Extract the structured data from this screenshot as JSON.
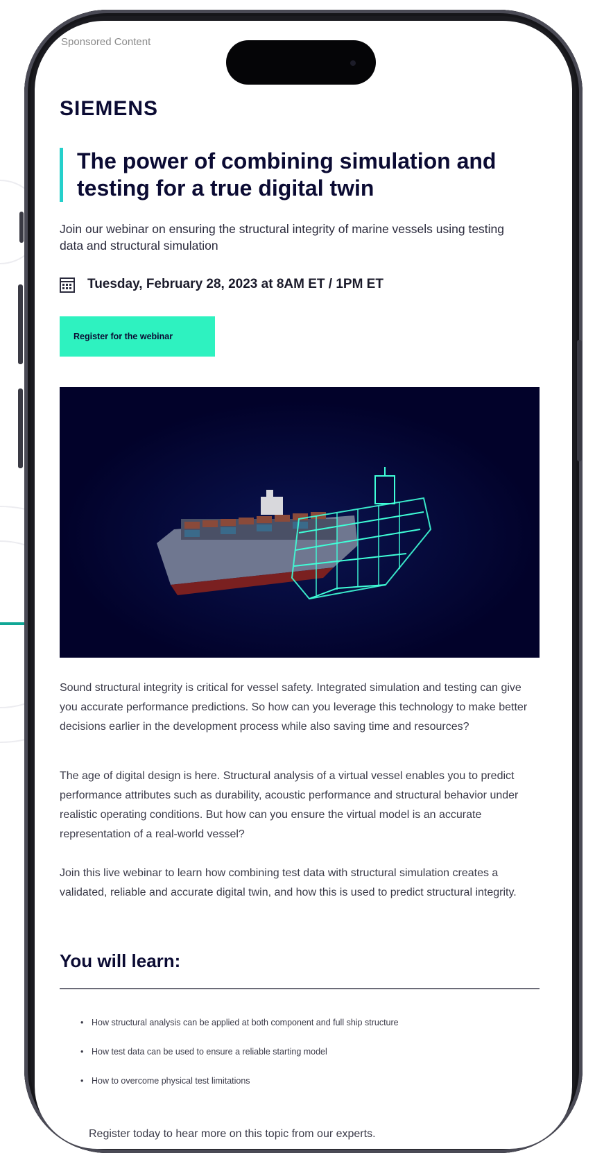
{
  "colors": {
    "accent_teal": "#25d0cb",
    "button_green": "#2ef2c0",
    "navy": "#0b0b33",
    "hero_bg": "#02022a",
    "connector": "#11a796"
  },
  "header": {
    "sponsored_label": "Sponsored Content",
    "brand": "SIEMENS"
  },
  "hero_section": {
    "title": "The power of combining simulation and testing for a true digital twin",
    "subtitle": "Join our webinar on ensuring the structural integrity of marine vessels using testing data and structural simulation",
    "date_icon": "calendar-icon",
    "date": "Tuesday, February 28, 2023 at 8AM ET / 1PM ET",
    "register_label": "Register for the webinar"
  },
  "body": {
    "paragraph_1": "Sound structural integrity is critical for vessel safety. Integrated simulation and testing can give you accurate performance predictions. So how can you leverage this technology to make better decisions earlier in the development process while also saving time and resources?",
    "paragraph_2": "The age of digital design is here. Structural analysis of a virtual vessel enables you to predict performance attributes such as durability, acoustic performance and structural behavior under realistic operating conditions. But how can you ensure the virtual model is an accurate representation of a real-world vessel?",
    "paragraph_3": "Join this live webinar to learn how combining test data with structural simulation creates a validated, reliable and accurate digital twin, and how this is used to predict structural integrity."
  },
  "learn": {
    "heading": "You will learn:",
    "items": [
      "How structural analysis can be applied at both component and full ship structure",
      "How test data can be used to ensure a reliable starting model",
      "How to overcome physical test limitations"
    ]
  },
  "footer": {
    "text": "Register today to hear more on this topic from our experts."
  }
}
